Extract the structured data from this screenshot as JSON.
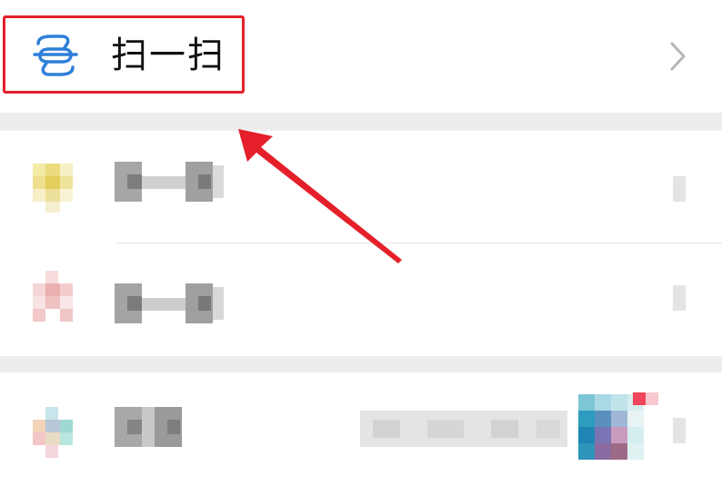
{
  "scan_row": {
    "label": "扫一扫",
    "icon": "scan-icon",
    "chevron": "chevron-right-icon"
  },
  "colors": {
    "highlight": "#e5202a",
    "arrow": "#e5202a",
    "icon_blue": "#2f7fd8",
    "gap": "#ededed"
  },
  "rows": [
    {
      "label": "",
      "icon": "pixelated-icon-yellow"
    },
    {
      "label": "",
      "icon": "pixelated-icon-pink"
    },
    {
      "label": "",
      "icon": "pixelated-icon-multicolor"
    }
  ]
}
